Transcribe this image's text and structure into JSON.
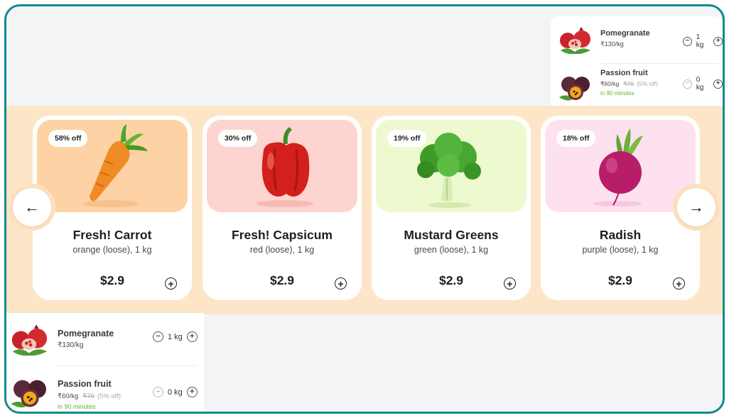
{
  "cart_top": {
    "items": [
      {
        "name": "Pomegranate",
        "price": "₹130/kg",
        "qty": "1 kg",
        "minus": "−",
        "plus": "+"
      },
      {
        "name": "Passion fruit",
        "price": "₹60/kg",
        "old_price": "₹70",
        "discount": "(5% off)",
        "eta": "in 90 minutes",
        "qty": "0 kg",
        "minus": "−",
        "plus": "+"
      }
    ]
  },
  "cart_bottom": {
    "items": [
      {
        "name": "Pomegranate",
        "price": "₹130/kg",
        "qty": "1 kg",
        "minus": "−",
        "plus": "+"
      },
      {
        "name": "Passion fruit",
        "price": "₹60/kg",
        "old_price": "₹70",
        "discount": "(5% off)",
        "eta": "in 90 minutes",
        "qty": "0 kg",
        "minus": "−",
        "plus": "+"
      }
    ]
  },
  "carousel": {
    "prev_icon": "←",
    "next_icon": "→",
    "products": [
      {
        "badge": "58% off",
        "title": "Fresh! Carrot",
        "sub": "orange (loose), 1 kg",
        "price": "$2.9",
        "add": "+",
        "bg": "#fdd2a4"
      },
      {
        "badge": "30% off",
        "title": "Fresh! Capsicum",
        "sub": "red (loose), 1 kg",
        "price": "$2.9",
        "add": "+",
        "bg": "#fdd4cf"
      },
      {
        "badge": "19% off",
        "title": "Mustard Greens",
        "sub": "green (loose), 1 kg",
        "price": "$2.9",
        "add": "+",
        "bg": "#edf9cf"
      },
      {
        "badge": "18% off",
        "title": "Radish",
        "sub": "purple (loose), 1 kg",
        "price": "$2.9",
        "add": "+",
        "bg": "#fde1ef"
      }
    ]
  },
  "colors": {
    "frame_border": "#118c8a",
    "band": "#fde5c8",
    "eta_green": "#5fb33b"
  }
}
